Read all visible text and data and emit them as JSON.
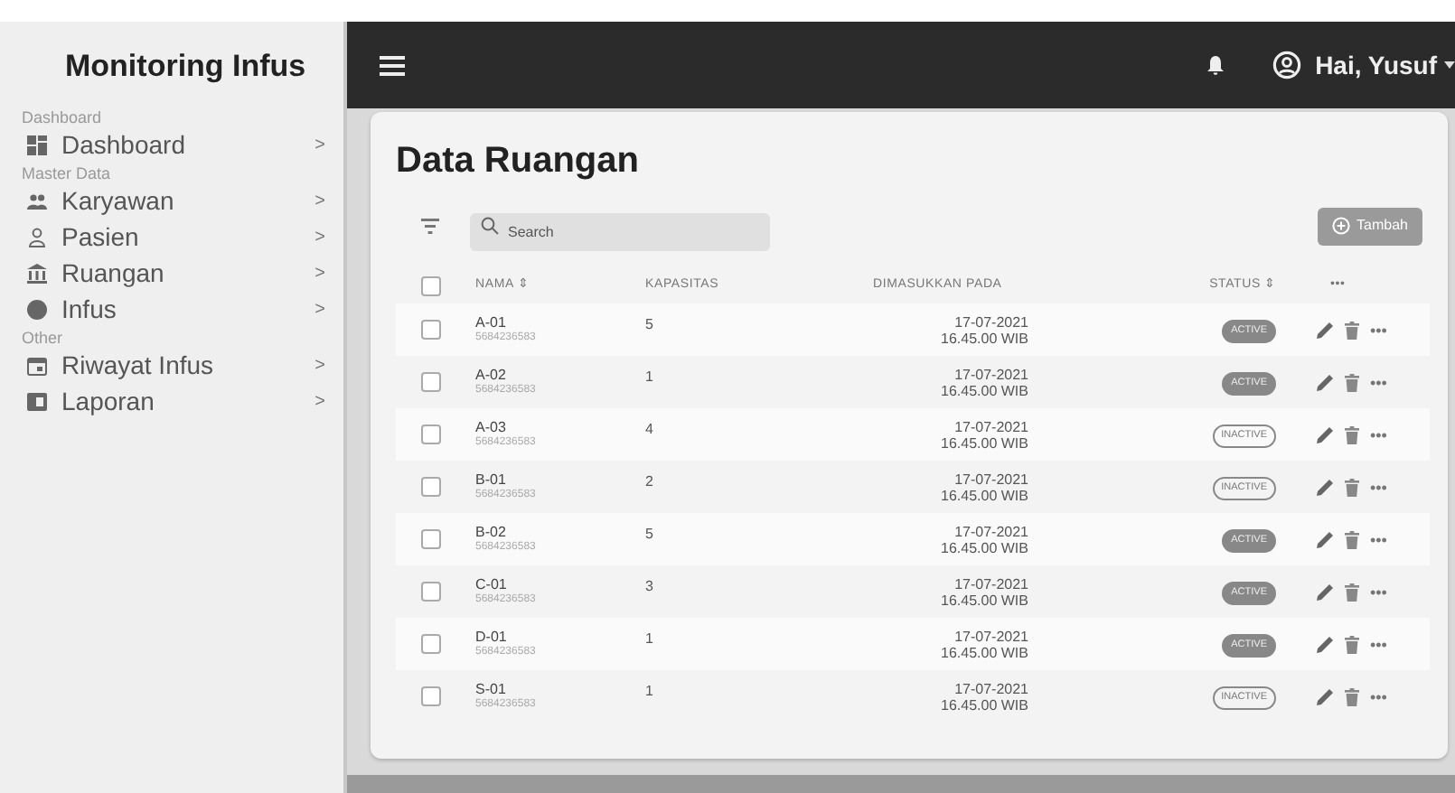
{
  "sidebar": {
    "title": "Monitoring Infus",
    "sections": [
      {
        "heading": "Dashboard",
        "items": [
          {
            "label": "Dashboard",
            "kind": "grid",
            "chevron": ">"
          }
        ]
      },
      {
        "heading": "Master Data",
        "items": [
          {
            "label": "Karyawan",
            "kind": "people",
            "chevron": ">"
          },
          {
            "label": "Pasien",
            "kind": "person",
            "chevron": ">"
          },
          {
            "label": "Ruangan",
            "kind": "building",
            "chevron": ">"
          },
          {
            "label": "Infus",
            "kind": "circle",
            "chevron": ">"
          }
        ]
      },
      {
        "heading": "Other",
        "items": [
          {
            "label": "Riwayat Infus",
            "kind": "calendar",
            "chevron": ">"
          },
          {
            "label": "Laporan",
            "kind": "report",
            "chevron": ">"
          }
        ]
      }
    ]
  },
  "topbar": {
    "user": "Hai, Yusuf"
  },
  "page": {
    "title": "Data Ruangan",
    "search": {
      "placeholder": "Search"
    },
    "add_button": "Tambah"
  },
  "table": {
    "all_checked": false,
    "columns": [
      "NAMA ⇕",
      "KAPASITAS",
      "DIMASUKKAN PADA",
      "STATUS ⇕",
      "•••"
    ],
    "rows": [
      {
        "name": "A-01",
        "code": "5684236583",
        "capacity": "5",
        "date": "17-07-2021",
        "time": "16.45.00 WIB",
        "status": "ACTIVE",
        "active": true,
        "checked": false
      },
      {
        "name": "A-02",
        "code": "5684236583",
        "capacity": "1",
        "date": "17-07-2021",
        "time": "16.45.00 WIB",
        "status": "ACTIVE",
        "active": true,
        "checked": false
      },
      {
        "name": "A-03",
        "code": "5684236583",
        "capacity": "4",
        "date": "17-07-2021",
        "time": "16.45.00 WIB",
        "status": "INACTIVE",
        "active": false,
        "checked": false
      },
      {
        "name": "B-01",
        "code": "5684236583",
        "capacity": "2",
        "date": "17-07-2021",
        "time": "16.45.00 WIB",
        "status": "INACTIVE",
        "active": false,
        "checked": false
      },
      {
        "name": "B-02",
        "code": "5684236583",
        "capacity": "5",
        "date": "17-07-2021",
        "time": "16.45.00 WIB",
        "status": "ACTIVE",
        "active": true,
        "checked": false
      },
      {
        "name": "C-01",
        "code": "5684236583",
        "capacity": "3",
        "date": "17-07-2021",
        "time": "16.45.00 WIB",
        "status": "ACTIVE",
        "active": true,
        "checked": false
      },
      {
        "name": "D-01",
        "code": "5684236583",
        "capacity": "1",
        "date": "17-07-2021",
        "time": "16.45.00 WIB",
        "status": "ACTIVE",
        "active": true,
        "checked": false
      },
      {
        "name": "S-01",
        "code": "5684236583",
        "capacity": "1",
        "date": "17-07-2021",
        "time": "16.45.00 WIB",
        "status": "INACTIVE",
        "active": false,
        "checked": false
      }
    ]
  }
}
